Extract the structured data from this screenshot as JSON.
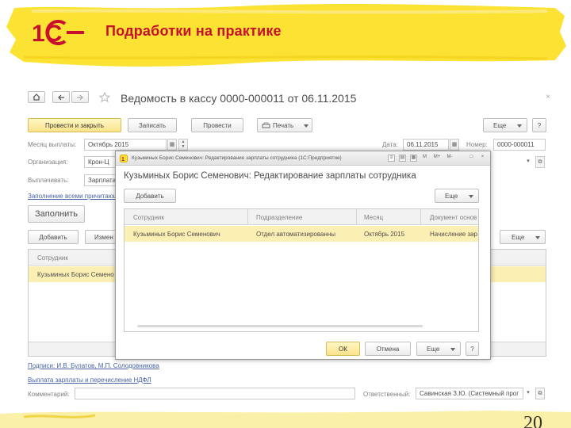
{
  "slide": {
    "title": "Подработки на практике",
    "logo_text": "1С",
    "page_number": "20"
  },
  "form": {
    "title": "Ведомость в кассу 0000-000011 от 06.11.2015",
    "nav": {
      "home_icon": "home-icon",
      "back_icon": "arrow-left-icon",
      "forward_icon": "arrow-right-icon",
      "favorite_icon": "star-icon",
      "close_icon": "close-icon"
    },
    "toolbar": {
      "post_and_close": "Провести и закрыть",
      "save": "Записать",
      "post": "Провести",
      "print": "Печать",
      "more": "Еще",
      "help": "?"
    },
    "fields": {
      "month_label": "Месяц выплаты:",
      "month_value": "Октябрь 2015",
      "date_label": "Дата:",
      "date_value": "06.11.2015",
      "number_label": "Номер:",
      "number_value": "0000-000011",
      "org_label": "Организация:",
      "org_value": "Крон-Ц",
      "pay_label": "Выплачивать:",
      "pay_value": "Зарплата",
      "comment_label": "Комментарий:",
      "responsible_label": "Ответственный:",
      "responsible_value": "Савинская З.Ю. (Системный прог"
    },
    "fill_link": "Заполнение всеми причитающ",
    "fill_button": "Заполнить",
    "table_toolbar": {
      "add": "Добавить",
      "edit": "Измен",
      "more": "Еще"
    },
    "table": {
      "column": "Сотрудник",
      "rows": [
        "Кузьминых Борис Семено"
      ]
    },
    "links": {
      "signatures": "Подписи: И.В. Булатов, М.П. Солодовникова",
      "ndfl": "Выплата зарплаты и перечисление НДФЛ"
    }
  },
  "dialog": {
    "window_title": "Кузьминых Борис Семенович: Редактирование зарплаты сотрудника (1С:Предприятие)",
    "window_buttons": [
      "M",
      "M+",
      "M-",
      "□",
      "×"
    ],
    "heading": "Кузьминых Борис Семенович: Редактирование зарплаты сотрудника",
    "add": "Добавить",
    "more": "Еще",
    "columns": [
      "Сотрудник",
      "Подразделение",
      "Месяц",
      "Документ основ"
    ],
    "row": [
      "Кузьминых Борис Семенович",
      "Отдел автоматизированны",
      "Октябрь 2015",
      "Начисление зар"
    ],
    "ok": "ОК",
    "cancel": "Отмена",
    "more_bottom": "Еще",
    "help": "?"
  },
  "colors": {
    "brand_red": "#c8102e",
    "banner_yellow": "#fbe233",
    "primary_button": "#fbe38c",
    "selected_row": "#fcefb4",
    "link": "#4664a4"
  }
}
